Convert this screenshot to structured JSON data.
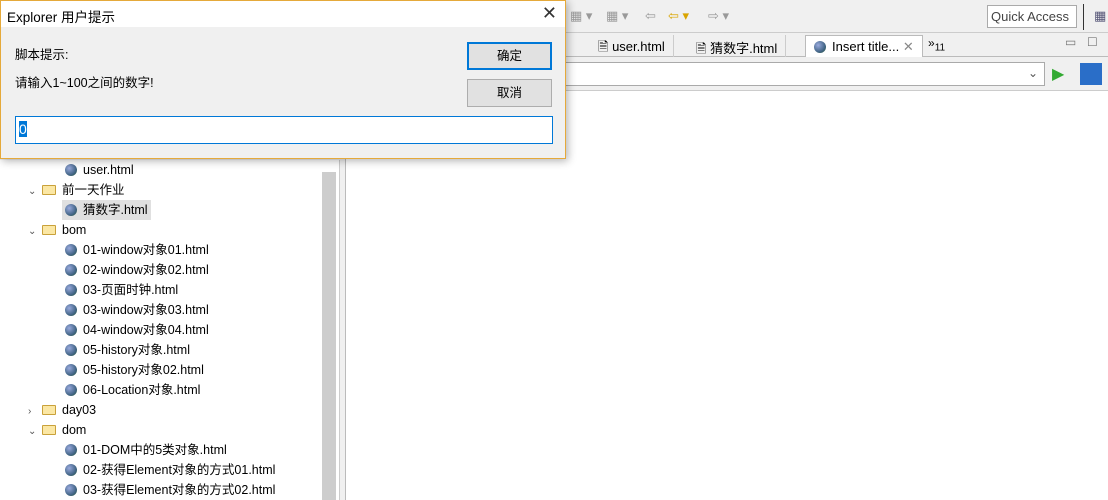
{
  "toolbar": {
    "quick_access": "Quick Access"
  },
  "tabs": [
    {
      "label": "user.html",
      "icon": "file-icon"
    },
    {
      "label": "猜数字.html",
      "icon": "file-icon"
    },
    {
      "label": "Insert title...",
      "icon": "globe-icon",
      "active": true
    }
  ],
  "tabs_overflow": {
    "symbol": "»",
    "count": "11"
  },
  "tree": [
    {
      "label": "user.html",
      "type": "file",
      "level": 2
    },
    {
      "label": "前一天作业",
      "type": "folder",
      "level": 1,
      "expanded": true
    },
    {
      "label": "猜数字.html",
      "type": "file",
      "level": 2,
      "selected": true
    },
    {
      "label": "bom",
      "type": "folder",
      "level": 1,
      "expanded": true
    },
    {
      "label": "01-window对象01.html",
      "type": "file",
      "level": 2
    },
    {
      "label": "02-window对象02.html",
      "type": "file",
      "level": 2
    },
    {
      "label": "03-页面时钟.html",
      "type": "file",
      "level": 2
    },
    {
      "label": "03-window对象03.html",
      "type": "file",
      "level": 2
    },
    {
      "label": "04-window对象04.html",
      "type": "file",
      "level": 2
    },
    {
      "label": "05-history对象.html",
      "type": "file",
      "level": 2
    },
    {
      "label": "05-history对象02.html",
      "type": "file",
      "level": 2
    },
    {
      "label": "06-Location对象.html",
      "type": "file",
      "level": 2
    },
    {
      "label": "day03",
      "type": "folder",
      "level": 1,
      "expanded": false
    },
    {
      "label": "dom",
      "type": "folder",
      "level": 1,
      "expanded": true
    },
    {
      "label": "01-DOM中的5类对象.html",
      "type": "file",
      "level": 2
    },
    {
      "label": "02-获得Element对象的方式01.html",
      "type": "file",
      "level": 2
    },
    {
      "label": "03-获得Element对象的方式02.html",
      "type": "file",
      "level": 2
    }
  ],
  "dialog": {
    "title": "Explorer 用户提示",
    "script_label": "脚本提示:",
    "message": "请输入1~100之间的数字!",
    "ok": "确定",
    "cancel": "取消",
    "input_value": "0"
  }
}
